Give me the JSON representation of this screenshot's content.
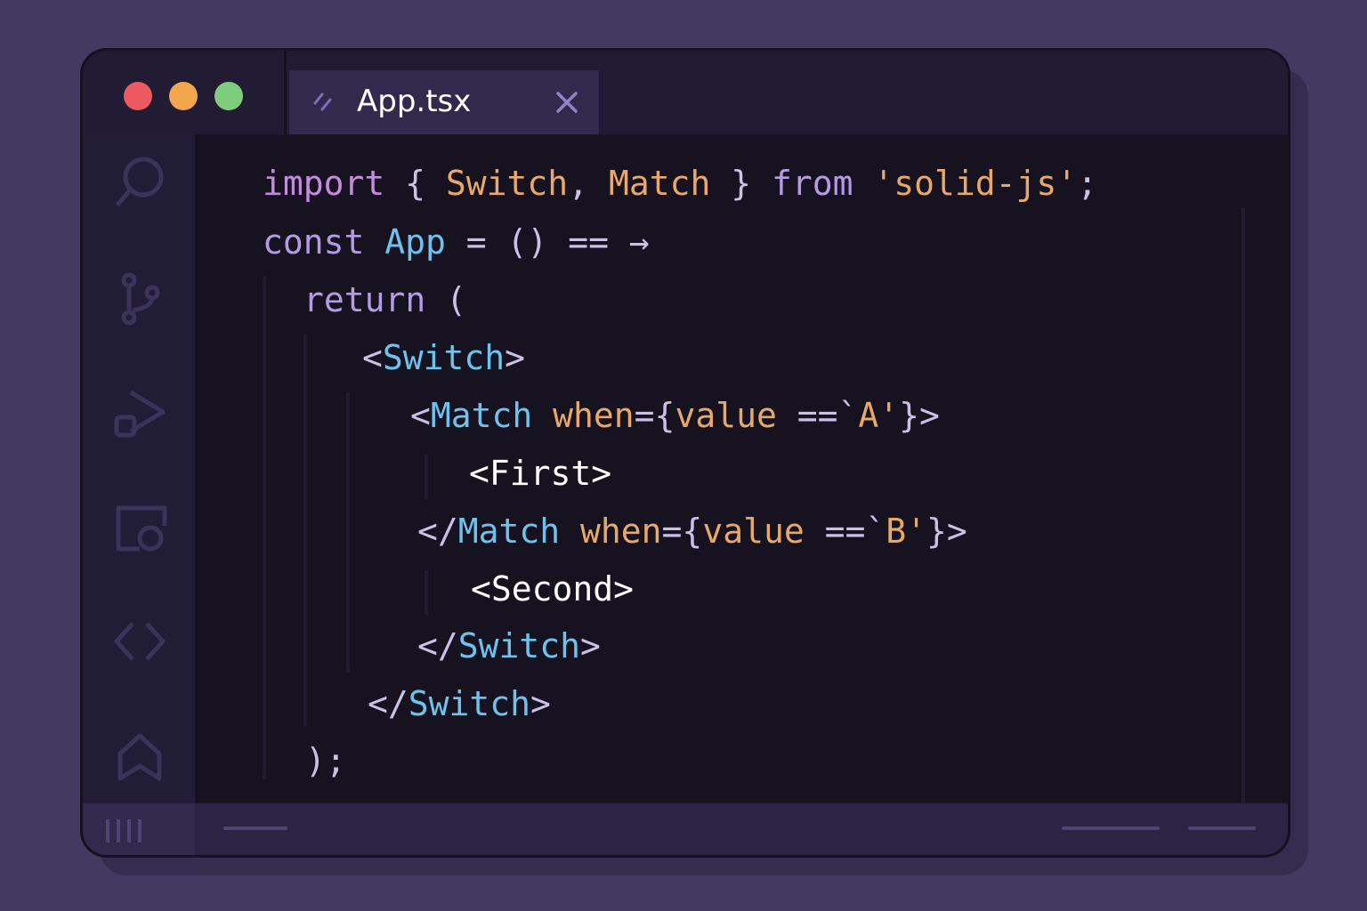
{
  "window": {
    "traffic_lights": [
      {
        "name": "close",
        "color": "#ec5a5f"
      },
      {
        "name": "minimize",
        "color": "#f3a64e"
      },
      {
        "name": "maximize",
        "color": "#7fcd7c"
      }
    ]
  },
  "tab": {
    "label": "App.tsx",
    "icon": "file-icon",
    "close_icon": "close-icon"
  },
  "activity_bar": {
    "icons": [
      "search-icon",
      "source-control-icon",
      "run-debug-icon",
      "remote-explorer-icon",
      "code-icon",
      "bookmark-icon"
    ]
  },
  "code": {
    "lines": [
      [
        {
          "t": "import",
          "c": "kw"
        },
        {
          "t": " { ",
          "c": "punct"
        },
        {
          "t": "Switch",
          "c": "ident"
        },
        {
          "t": ", ",
          "c": "punct"
        },
        {
          "t": "Match",
          "c": "ident"
        },
        {
          "t": " } ",
          "c": "punct"
        },
        {
          "t": "from",
          "c": "kw2"
        },
        {
          "t": " 'solid-js'",
          "c": "str"
        },
        {
          "t": ";",
          "c": "punct"
        }
      ],
      [
        {
          "t": "const",
          "c": "kw2"
        },
        {
          "t": " ",
          "c": "punct"
        },
        {
          "t": "App",
          "c": "tag"
        },
        {
          "t": " = () == →",
          "c": "punct"
        }
      ],
      [
        {
          "t": "return",
          "c": "kw2"
        },
        {
          "t": " (",
          "c": "punct"
        }
      ],
      [
        {
          "t": "<",
          "c": "punct"
        },
        {
          "t": "Switch",
          "c": "tag"
        },
        {
          "t": ">",
          "c": "punct"
        }
      ],
      [
        {
          "t": "<",
          "c": "punct"
        },
        {
          "t": "Match",
          "c": "tag"
        },
        {
          "t": " when",
          "c": "ident"
        },
        {
          "t": "={",
          "c": "punct"
        },
        {
          "t": "value",
          "c": "ident"
        },
        {
          "t": " ==`",
          "c": "punct"
        },
        {
          "t": "A'",
          "c": "str"
        },
        {
          "t": "}>",
          "c": "punct"
        }
      ],
      [
        {
          "t": "<First>",
          "c": "white"
        }
      ],
      [
        {
          "t": "</",
          "c": "punct"
        },
        {
          "t": "Match",
          "c": "tag"
        },
        {
          "t": " when",
          "c": "ident"
        },
        {
          "t": "={",
          "c": "punct"
        },
        {
          "t": "value",
          "c": "ident"
        },
        {
          "t": " ==`",
          "c": "punct"
        },
        {
          "t": "B'",
          "c": "str"
        },
        {
          "t": "}>",
          "c": "punct"
        }
      ],
      [
        {
          "t": "<Second>",
          "c": "white"
        }
      ],
      [
        {
          "t": "</",
          "c": "punct"
        },
        {
          "t": "Switch",
          "c": "tag"
        },
        {
          "t": ">",
          "c": "punct"
        }
      ],
      [
        {
          "t": "</",
          "c": "punct"
        },
        {
          "t": "Switch",
          "c": "tag"
        },
        {
          "t": ">",
          "c": "punct"
        }
      ],
      [
        {
          "t": ");",
          "c": "punct"
        }
      ]
    ]
  },
  "status_bar": {
    "left_icon": "panel-toggle-icon"
  }
}
